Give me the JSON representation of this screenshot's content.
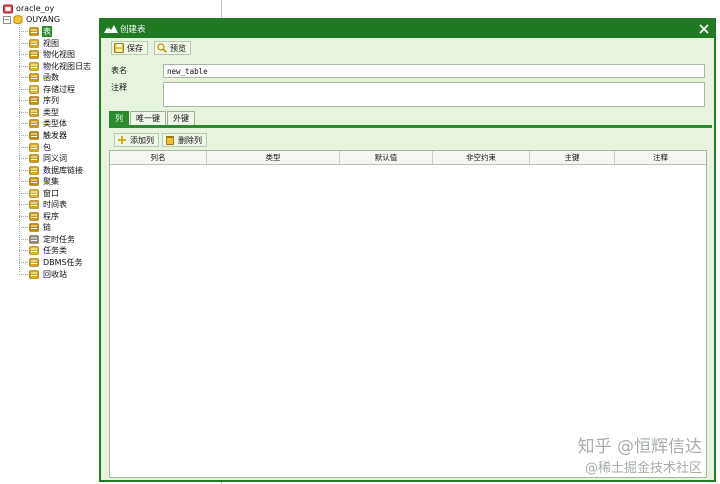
{
  "tree": {
    "connection": "oracle_oy",
    "schema": "OUYANG",
    "items": [
      {
        "label": "表",
        "icon": "table-icon",
        "selected": true
      },
      {
        "label": "视图",
        "icon": "view-icon"
      },
      {
        "label": "物化视图",
        "icon": "materialized-view-icon"
      },
      {
        "label": "物化视图日志",
        "icon": "materialized-view-log-icon"
      },
      {
        "label": "函数",
        "icon": "function-icon"
      },
      {
        "label": "存储过程",
        "icon": "procedure-icon"
      },
      {
        "label": "序列",
        "icon": "sequence-icon"
      },
      {
        "label": "类型",
        "icon": "type-icon"
      },
      {
        "label": "类型体",
        "icon": "type-body-icon"
      },
      {
        "label": "触发器",
        "icon": "trigger-icon"
      },
      {
        "label": "包",
        "icon": "package-icon"
      },
      {
        "label": "同义词",
        "icon": "synonym-icon"
      },
      {
        "label": "数据库链接",
        "icon": "database-link-icon"
      },
      {
        "label": "聚集",
        "icon": "cluster-icon"
      },
      {
        "label": "窗口",
        "icon": "window-icon"
      },
      {
        "label": "时间表",
        "icon": "schedule-icon"
      },
      {
        "label": "程序",
        "icon": "program-icon"
      },
      {
        "label": "链",
        "icon": "chain-icon"
      },
      {
        "label": "定时任务",
        "icon": "scheduled-job-icon"
      },
      {
        "label": "任务类",
        "icon": "job-class-icon"
      },
      {
        "label": "DBMS任务",
        "icon": "dbms-job-icon"
      },
      {
        "label": "回收站",
        "icon": "recycle-bin-icon"
      }
    ]
  },
  "dialog": {
    "title": "创建表",
    "save_label": "保存",
    "preview_label": "预览",
    "table_name_label": "表名",
    "table_name_value": "new_table",
    "comment_label": "注释",
    "comment_value": "",
    "tabs": [
      "列",
      "唯一键",
      "外键"
    ],
    "active_tab": 0,
    "add_column_label": "添加列",
    "delete_column_label": "删除列",
    "columns": [
      "列名",
      "类型",
      "默认值",
      "非空约束",
      "主键",
      "注释"
    ]
  },
  "watermark": {
    "line1": "知乎 @恒辉信达",
    "line2": "@稀土掘金技术社区"
  },
  "colors": {
    "accent": "#1f7a22",
    "dialog_bg": "#e6f3dd",
    "selection": "#2e8b2e"
  }
}
